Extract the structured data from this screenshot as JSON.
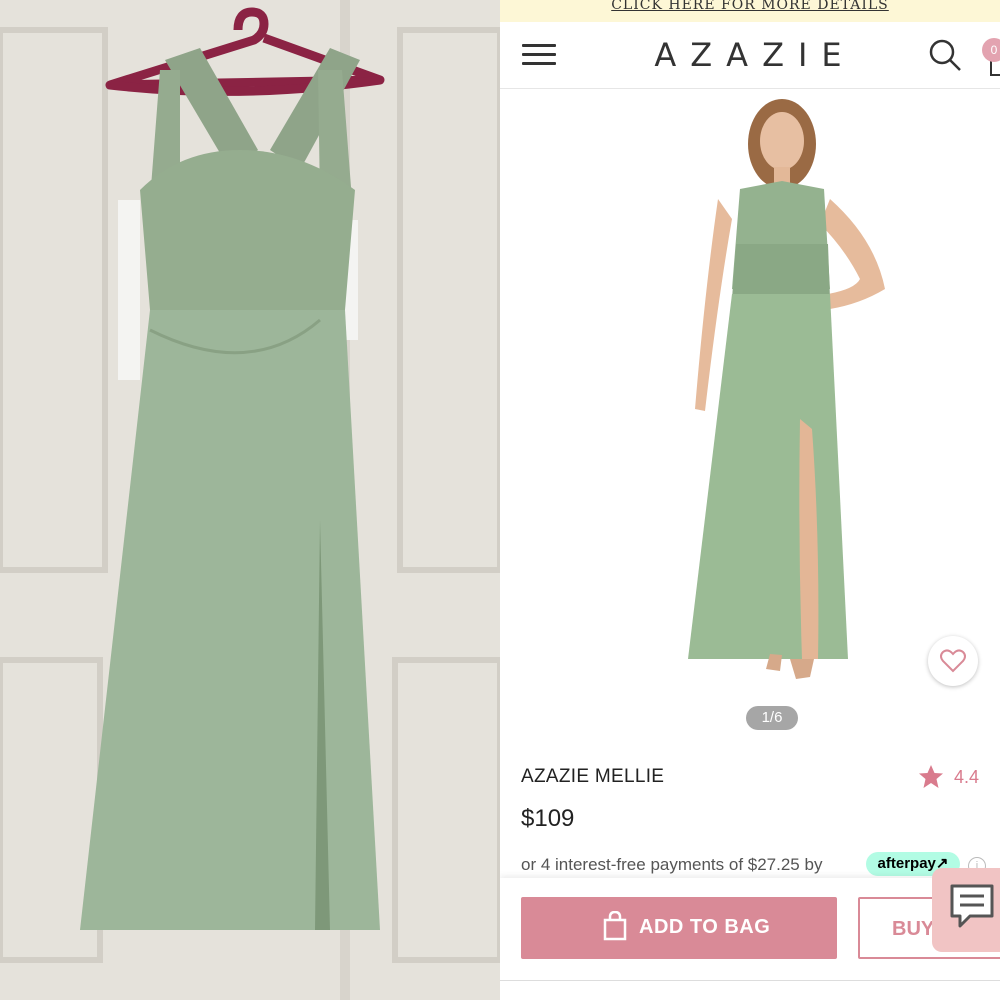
{
  "promo": {
    "text": "CLICK HERE FOR MORE DETAILS"
  },
  "header": {
    "brand": "AZAZIE",
    "bag_count": "0"
  },
  "gallery": {
    "pager": "1/6"
  },
  "product": {
    "name": "AZAZIE MELLIE",
    "rating": "4.4",
    "price": "$109",
    "installment_text": "or 4 interest-free payments of $27.25 by",
    "afterpay_label": "afterpay"
  },
  "actions": {
    "add_to_bag": "ADD TO BAG",
    "buy_now": "BUY"
  },
  "colors": {
    "accent": "#d98a97",
    "dress": "#8fb18c",
    "afterpay": "#b2fce4"
  },
  "icons": [
    "menu-icon",
    "search-icon",
    "bag-icon",
    "heart-icon",
    "star-icon",
    "shopping-bag-icon",
    "chat-icon",
    "info-icon"
  ]
}
